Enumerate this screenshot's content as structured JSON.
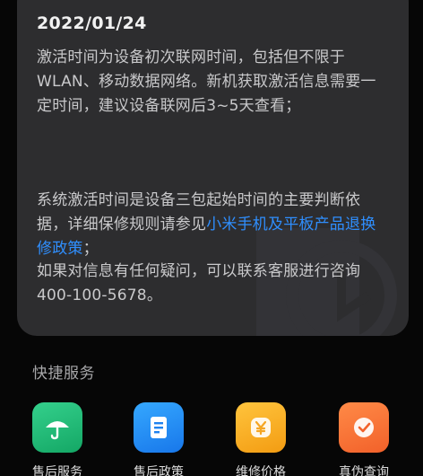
{
  "info_card": {
    "date": "2022/01/24",
    "paragraph_1": "激活时间为设备初次联网时间，包括但不限于WLAN、移动数据网络。新机获取激活信息需要一定时间，建议设备联网后3~5天查看；",
    "paragraph_2_before_link": "系统激活时间是设备三包起始时间的主要判断依据，详细保修规则请参见",
    "paragraph_2_link": "小米手机及平板产品退换修政策",
    "paragraph_2_after_link": "；",
    "paragraph_3": "如果对信息有任何疑问，可以联系客服进行咨询400-100-5678。"
  },
  "quick_services": {
    "title": "快捷服务",
    "items": [
      {
        "label": "售后服务",
        "icon": "umbrella-icon",
        "color": "#1fb874"
      },
      {
        "label": "售后政策",
        "icon": "document-icon",
        "color": "#2188f5"
      },
      {
        "label": "维修价格",
        "icon": "yen-icon",
        "color": "#f7ae24"
      },
      {
        "label": "真伪查询",
        "icon": "verified-badge-icon",
        "color": "#f7713a"
      }
    ]
  }
}
